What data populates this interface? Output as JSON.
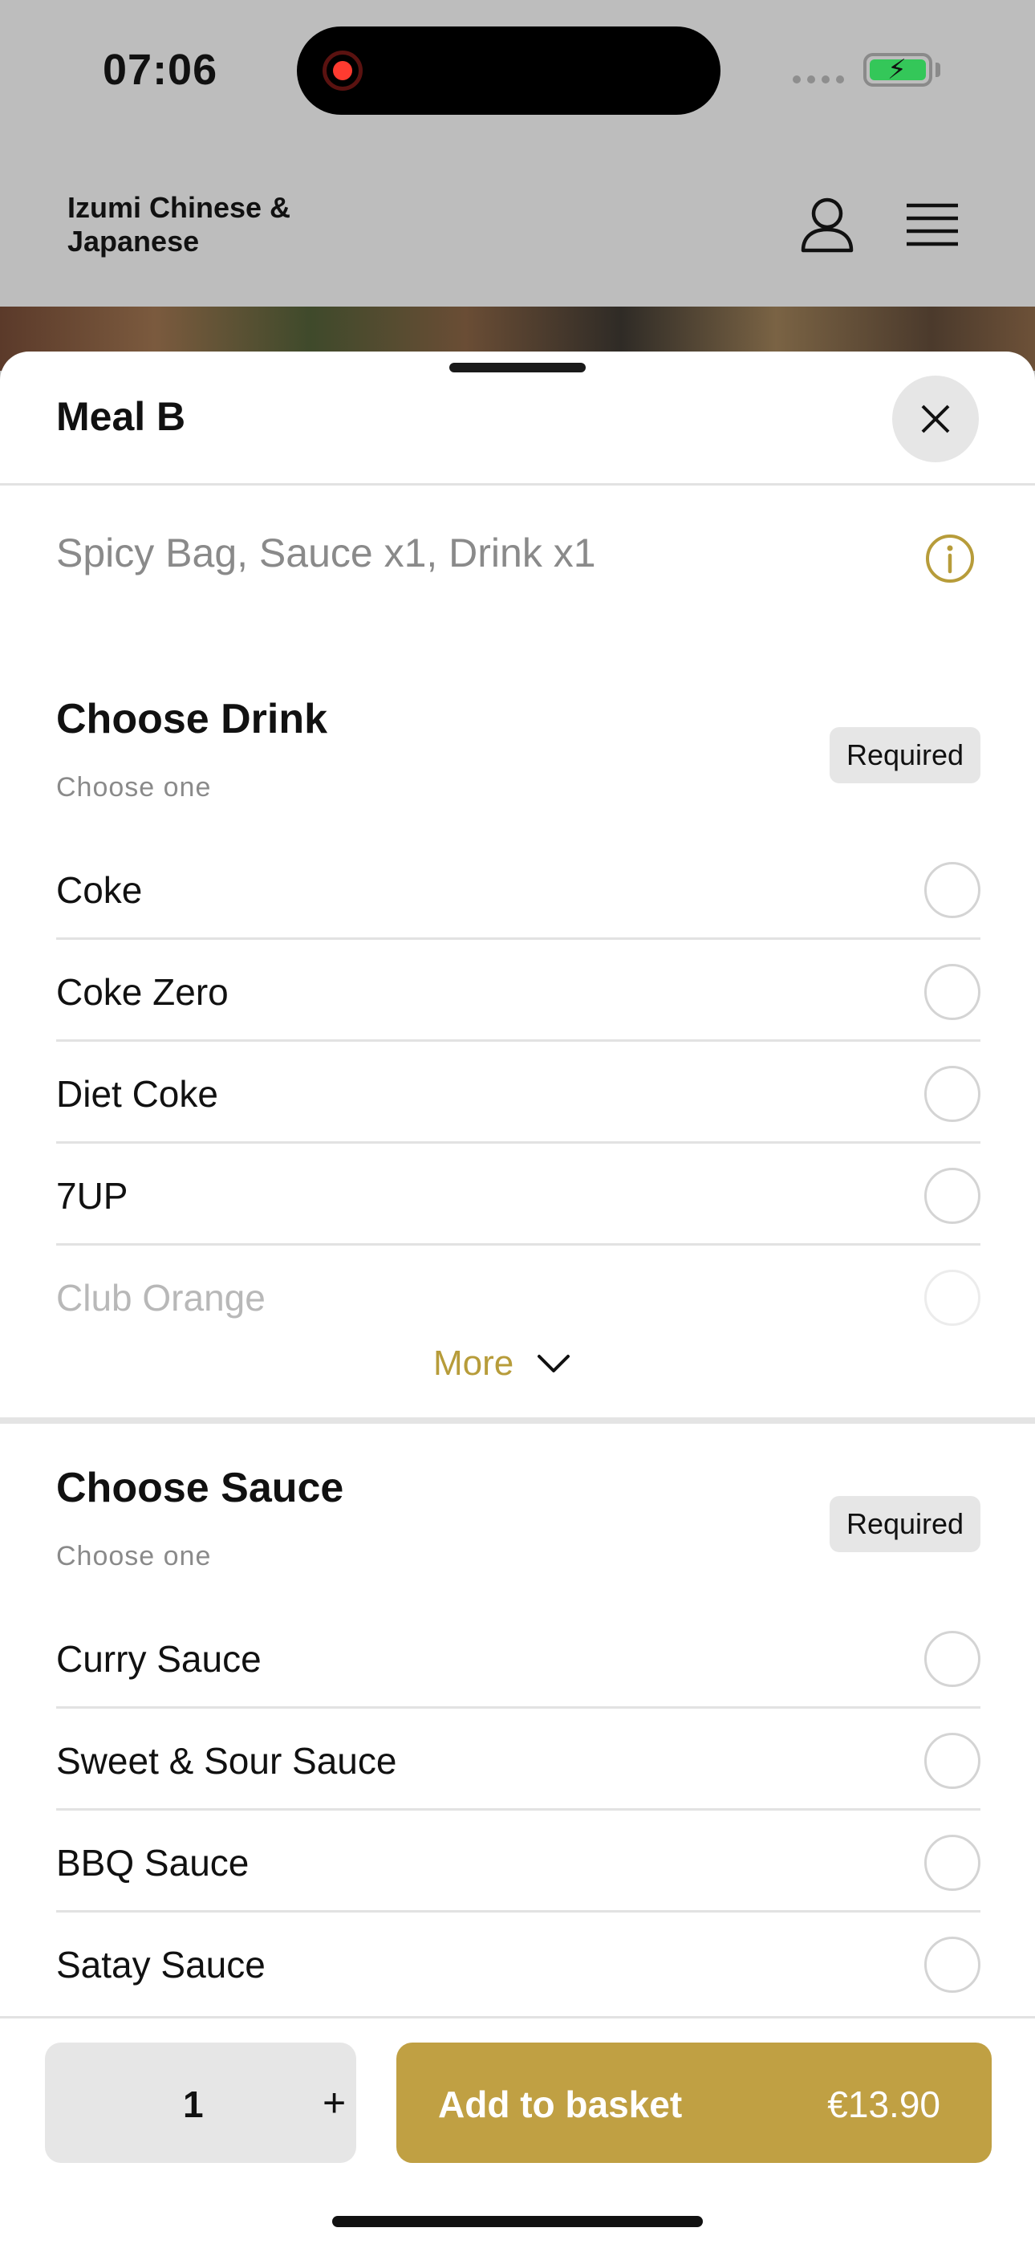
{
  "status_bar": {
    "time": "07:06"
  },
  "header": {
    "restaurant_name": "Izumi Chinese & Japanese",
    "icons": [
      "user-icon",
      "hamburger-menu-icon"
    ]
  },
  "sheet": {
    "title": "Meal B",
    "description": "Spicy Bag, Sauce x1, Drink x1",
    "groups": [
      {
        "title": "Choose Drink",
        "subtitle": "Choose one",
        "badge": "Required",
        "options": [
          "Coke",
          "Coke Zero",
          "Diet Coke",
          "7UP",
          "Club Orange"
        ],
        "more_label": "More"
      },
      {
        "title": "Choose Sauce",
        "subtitle": "Choose one",
        "badge": "Required",
        "options": [
          "Curry Sauce",
          "Sweet & Sour Sauce",
          "BBQ Sauce",
          "Satay Sauce"
        ]
      }
    ]
  },
  "footer": {
    "quantity": "1",
    "plus_label": "+",
    "add_label": "Add to basket",
    "price": "€13.90"
  },
  "colors": {
    "accent": "#c0a043",
    "accent_text": "#b79c3a",
    "badge_bg": "#e6e6e6",
    "overlay": "#bdbdbd"
  }
}
